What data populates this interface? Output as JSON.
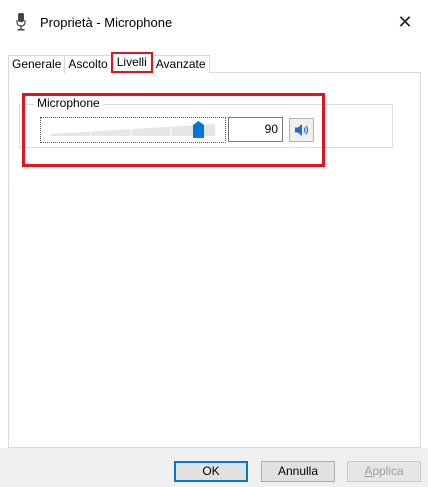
{
  "window": {
    "title": "Proprietà - Microphone",
    "close_glyph": "✕",
    "title_icon": "microphone-icon"
  },
  "tabs": [
    {
      "label": "Generale",
      "active": false
    },
    {
      "label": "Ascolto",
      "active": false
    },
    {
      "label": "Livelli",
      "active": true
    },
    {
      "label": "Avanzate",
      "active": false
    }
  ],
  "levels": {
    "group_label": "Microphone",
    "value": "90",
    "slider_level_percent": 90,
    "speaker_icon": "speaker-icon"
  },
  "buttons": {
    "ok": "OK",
    "cancel": "Annulla",
    "apply_first": "A",
    "apply_rest": "pplica"
  },
  "colors": {
    "highlight": "#e0141e",
    "accent": "#0078d7"
  }
}
